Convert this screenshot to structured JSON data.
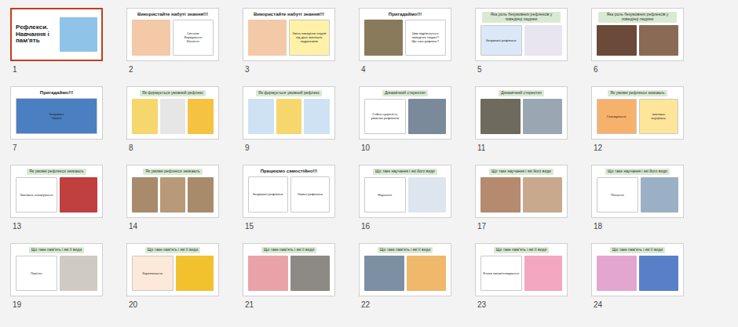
{
  "slides": [
    {
      "number": "1",
      "selected": true,
      "titleKind": "cover",
      "title": "Рефлекси. Навчання і пам'ять",
      "blocks": [
        {
          "kind": "photo",
          "color": "#8fc3e8"
        }
      ]
    },
    {
      "number": "2",
      "selected": false,
      "titleKind": "plain",
      "title": "Використайте набуті знання!!!",
      "blocks": [
        {
          "kind": "photo",
          "color": "#f4c9a8"
        },
        {
          "kind": "box",
          "text": "Сигнали\nФормування\nКількість",
          "color": "#ffffff"
        }
      ]
    },
    {
      "number": "3",
      "selected": false,
      "titleKind": "plain",
      "title": "Використайте набуті знання!!!",
      "blocks": [
        {
          "kind": "photo",
          "color": "#f4c9a8"
        },
        {
          "kind": "box",
          "text": "Зміна поведінки людей під дією зовнішніх подразників",
          "color": "#fff2a8"
        }
      ]
    },
    {
      "number": "4",
      "selected": false,
      "titleKind": "plain",
      "title": "Пригадаймо!!!",
      "blocks": [
        {
          "kind": "photo",
          "color": "#8a7a5c"
        },
        {
          "kind": "box",
          "text": "Чим відрізняється поведінка тварин?\nЩо таке рефлекс?",
          "color": "#ffffff"
        }
      ]
    },
    {
      "number": "5",
      "selected": false,
      "titleKind": "pill",
      "title": "Яка роль безумовних рефлексів у поведінці людини",
      "blocks": [
        {
          "kind": "box",
          "text": "Безумовні рефлекси",
          "color": "#dbe8f7"
        },
        {
          "kind": "photo",
          "color": "#e8e4f0"
        }
      ]
    },
    {
      "number": "6",
      "selected": false,
      "titleKind": "pill",
      "title": "Яка роль безумовних рефлексів у поведінці людини",
      "blocks": [
        {
          "kind": "photo",
          "color": "#6b4a3a"
        },
        {
          "kind": "photo",
          "color": "#8a6a55"
        }
      ]
    },
    {
      "number": "7",
      "selected": false,
      "titleKind": "plain",
      "title": "Пригадаймо!!!",
      "blocks": [
        {
          "kind": "box",
          "text": "Безумовні\nУмовні",
          "color": "#4a7fc1"
        }
      ]
    },
    {
      "number": "8",
      "selected": false,
      "titleKind": "pill",
      "title": "Як формується умовний рефлекс",
      "blocks": [
        {
          "kind": "photo",
          "color": "#f5d76e"
        },
        {
          "kind": "photo",
          "color": "#e6e6e6"
        },
        {
          "kind": "photo",
          "color": "#f5c242"
        }
      ]
    },
    {
      "number": "9",
      "selected": false,
      "titleKind": "pill",
      "title": "Як формується умовний рефлекс",
      "blocks": [
        {
          "kind": "photo",
          "color": "#cfe2f3"
        },
        {
          "kind": "photo",
          "color": "#f5d76e"
        },
        {
          "kind": "photo",
          "color": "#cfe2f3"
        }
      ]
    },
    {
      "number": "10",
      "selected": false,
      "titleKind": "pill",
      "title": "Динамічний стереотип",
      "blocks": [
        {
          "kind": "box",
          "text": "Стійка сукупність умовних рефлексів",
          "color": "#ffffff"
        },
        {
          "kind": "photo",
          "color": "#7a8a9a"
        }
      ]
    },
    {
      "number": "11",
      "selected": false,
      "titleKind": "pill",
      "title": "Динамічний стереотип",
      "blocks": [
        {
          "kind": "photo",
          "color": "#6f6a5e"
        },
        {
          "kind": "photo",
          "color": "#9aa6b2"
        }
      ]
    },
    {
      "number": "12",
      "selected": false,
      "titleKind": "pill",
      "title": "Як умовні рефлекси зникають",
      "blocks": [
        {
          "kind": "box",
          "text": "Гальмування",
          "color": "#f6b26b"
        },
        {
          "kind": "box",
          "text": "зовнішнє\nвнутрішнє",
          "color": "#ffe599"
        }
      ]
    },
    {
      "number": "13",
      "selected": false,
      "titleKind": "pill",
      "title": "Як умовні рефлекси зникають",
      "blocks": [
        {
          "kind": "box",
          "text": "Зовнішнє гальмування",
          "color": "#ffffff"
        },
        {
          "kind": "photo",
          "color": "#c04040"
        }
      ]
    },
    {
      "number": "14",
      "selected": false,
      "titleKind": "pill",
      "title": "Як умовні рефлекси зникають",
      "blocks": [
        {
          "kind": "photo",
          "color": "#a78b6b"
        },
        {
          "kind": "photo",
          "color": "#b89a78"
        },
        {
          "kind": "photo",
          "color": "#a78b6b"
        }
      ]
    },
    {
      "number": "15",
      "selected": false,
      "titleKind": "plain",
      "title": "Працюємо самостійно!!!",
      "blocks": [
        {
          "kind": "box",
          "text": "Безумовні рефлекси",
          "color": "#ffffff"
        },
        {
          "kind": "box",
          "text": "Умовні рефлекси",
          "color": "#ffffff"
        }
      ]
    },
    {
      "number": "16",
      "selected": false,
      "titleKind": "pill",
      "title": "Що таке научання і які його види",
      "blocks": [
        {
          "kind": "box",
          "text": "Научання",
          "color": "#ffffff"
        },
        {
          "kind": "photo",
          "color": "#dde6ee"
        }
      ]
    },
    {
      "number": "17",
      "selected": false,
      "titleKind": "pill",
      "title": "Що таке научання і які його види",
      "blocks": [
        {
          "kind": "photo",
          "color": "#b58a6e"
        },
        {
          "kind": "photo",
          "color": "#c9a98e"
        }
      ]
    },
    {
      "number": "18",
      "selected": false,
      "titleKind": "pill",
      "title": "Що таке научання і які його види",
      "blocks": [
        {
          "kind": "box",
          "text": "Пізнання",
          "color": "#ffffff"
        },
        {
          "kind": "photo",
          "color": "#9bb0c4"
        }
      ]
    },
    {
      "number": "19",
      "selected": false,
      "titleKind": "pill",
      "title": "Що таке пам'ять і які її види",
      "blocks": [
        {
          "kind": "box",
          "text": "Пам'ять",
          "color": "#ffffff"
        },
        {
          "kind": "photo",
          "color": "#cfcac4"
        }
      ]
    },
    {
      "number": "20",
      "selected": false,
      "titleKind": "pill",
      "title": "Що таке пам'ять і які її види",
      "blocks": [
        {
          "kind": "box",
          "text": "Короткочасна",
          "color": "#fde9d9"
        },
        {
          "kind": "photo",
          "color": "#f2c12e"
        }
      ]
    },
    {
      "number": "21",
      "selected": false,
      "titleKind": "pill",
      "title": "Що таке пам'ять і які її види",
      "blocks": [
        {
          "kind": "photo",
          "color": "#e9a3a8"
        },
        {
          "kind": "photo",
          "color": "#8d8a86"
        }
      ]
    },
    {
      "number": "22",
      "selected": false,
      "titleKind": "pill",
      "title": "Що таке пам'ять і які її види",
      "blocks": [
        {
          "kind": "photo",
          "color": "#7d8fa3"
        },
        {
          "kind": "photo",
          "color": "#f0b86a"
        }
      ]
    },
    {
      "number": "23",
      "selected": false,
      "titleKind": "pill",
      "title": "Що таке пам'ять і які її види",
      "blocks": [
        {
          "kind": "box",
          "text": "Етапи запам'ятовування",
          "color": "#ffffff"
        },
        {
          "kind": "photo",
          "color": "#f4a7c0"
        }
      ]
    },
    {
      "number": "24",
      "selected": false,
      "titleKind": "pill",
      "title": "Що таке пам'ять і які її види",
      "blocks": [
        {
          "kind": "photo",
          "color": "#e3a6d0"
        },
        {
          "kind": "photo",
          "color": "#5a7fc9"
        }
      ]
    }
  ]
}
